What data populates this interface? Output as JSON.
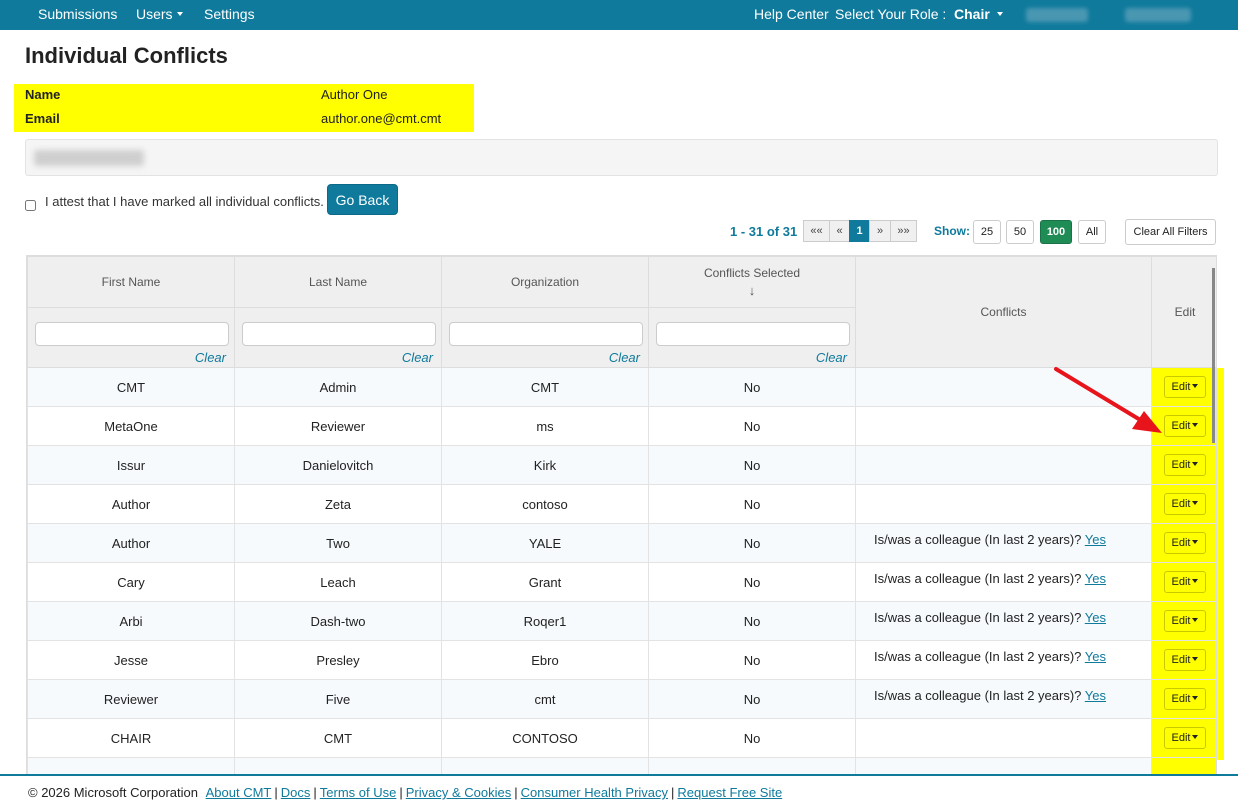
{
  "nav": {
    "submissions": "Submissions",
    "users": "Users",
    "settings": "Settings",
    "help_center": "Help Center",
    "select_role_label": "Select Your Role :",
    "role": "Chair"
  },
  "page": {
    "title": "Individual Conflicts"
  },
  "info": {
    "name_label": "Name",
    "name_value": "Author One",
    "email_label": "Email",
    "email_value": "author.one@cmt.cmt"
  },
  "attest": {
    "text": "I attest that I have marked all individual conflicts.",
    "go_back": "Go Back"
  },
  "pagination": {
    "range_prefix": "1 - 31 of ",
    "total": "31",
    "first": "««",
    "prev": "«",
    "current": "1",
    "next": "»",
    "last": "»»"
  },
  "show": {
    "label": "Show:",
    "options": [
      "25",
      "50",
      "100",
      "All"
    ],
    "selected": "100"
  },
  "clear_all_filters": "Clear All Filters",
  "table": {
    "headers": {
      "first_name": "First Name",
      "last_name": "Last Name",
      "organization": "Organization",
      "conflicts_selected": "Conflicts Selected",
      "sort_arrow": "↓",
      "conflicts": "Conflicts",
      "edit": "Edit"
    },
    "clear_label": "Clear",
    "edit_label": "Edit",
    "conflict_text": "Is/was a colleague (In last 2 years)?",
    "conflict_link": "Yes",
    "rows": [
      {
        "first": "CMT",
        "last": "Admin",
        "org": "CMT",
        "selected": "No",
        "conflict": false
      },
      {
        "first": "MetaOne",
        "last": "Reviewer",
        "org": "ms",
        "selected": "No",
        "conflict": false
      },
      {
        "first": "Issur",
        "last": "Danielovitch",
        "org": "Kirk",
        "selected": "No",
        "conflict": false
      },
      {
        "first": "Author",
        "last": "Zeta",
        "org": "contoso",
        "selected": "No",
        "conflict": false
      },
      {
        "first": "Author",
        "last": "Two",
        "org": "YALE",
        "selected": "No",
        "conflict": true
      },
      {
        "first": "Cary",
        "last": "Leach",
        "org": "Grant",
        "selected": "No",
        "conflict": true
      },
      {
        "first": "Arbi",
        "last": "Dash-two",
        "org": "Roqer1",
        "selected": "No",
        "conflict": true
      },
      {
        "first": "Jesse",
        "last": "Presley",
        "org": "Ebro",
        "selected": "No",
        "conflict": true
      },
      {
        "first": "Reviewer",
        "last": "Five",
        "org": "cmt",
        "selected": "No",
        "conflict": true
      },
      {
        "first": "CHAIR",
        "last": "CMT",
        "org": "CONTOSO",
        "selected": "No",
        "conflict": false
      }
    ]
  },
  "footer": {
    "copyright": "© 2026 Microsoft Corporation",
    "links": [
      "About CMT",
      "Docs",
      "Terms of Use",
      "Privacy & Cookies",
      "Consumer Health Privacy",
      "Request Free Site"
    ]
  },
  "colors": {
    "brand": "#0f7a9c",
    "highlight": "#ffff00",
    "active_show": "#1f8c55",
    "arrow": "#e8141c"
  }
}
